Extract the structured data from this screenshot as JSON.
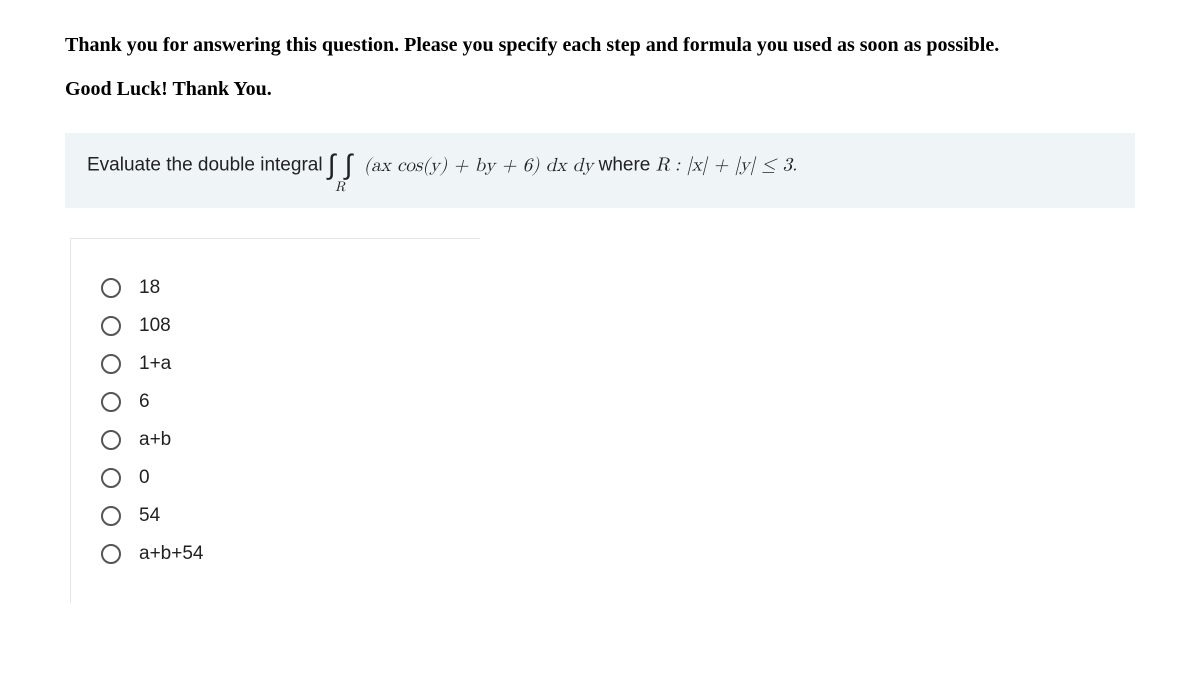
{
  "intro": {
    "line1": "Thank you for answering this question. Please you specify each step and formula you used as soon as possible.",
    "line2": "Good Luck! Thank You."
  },
  "question": {
    "prefix": "Evaluate the double integral ",
    "integrand": "(ax cos(y) + by + 6) dx dy",
    "mid": " where ",
    "region_var": "R",
    "condition": " :  |x| + |y| ≤ 3."
  },
  "options": [
    {
      "label": "18"
    },
    {
      "label": "108"
    },
    {
      "label": "1+a"
    },
    {
      "label": "6"
    },
    {
      "label": "a+b"
    },
    {
      "label": "0"
    },
    {
      "label": "54"
    },
    {
      "label": "a+b+54"
    }
  ]
}
